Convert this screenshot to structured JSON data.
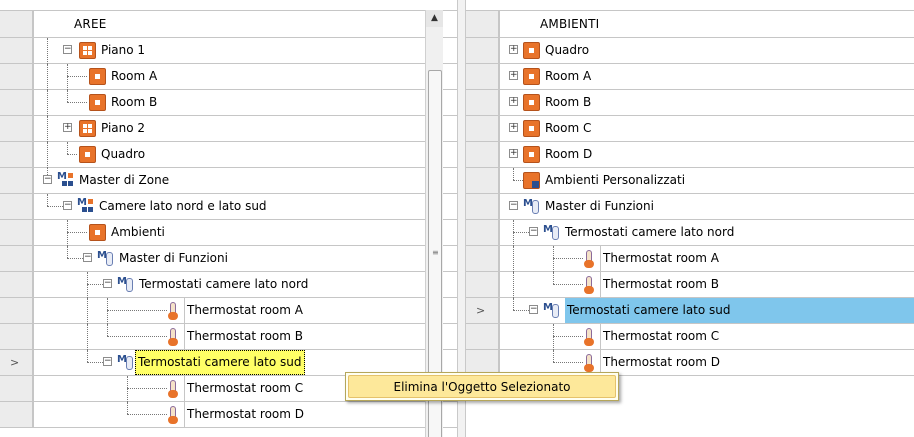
{
  "left": {
    "header": "AREE",
    "rows": [
      {
        "label": "Piano 1",
        "icon": "floor-icon",
        "expander": "minus"
      },
      {
        "label": "Room A",
        "icon": "room-icon"
      },
      {
        "label": "Room B",
        "icon": "room-icon"
      },
      {
        "label": "Piano 2",
        "icon": "floor-icon",
        "expander": "plus"
      },
      {
        "label": "Quadro",
        "icon": "room-icon"
      },
      {
        "label": "Master di Zone",
        "icon": "zone-master-icon",
        "expander": "minus"
      },
      {
        "label": "Camere lato nord e lato sud",
        "icon": "zone-master-icon",
        "expander": "minus"
      },
      {
        "label": "Ambienti",
        "icon": "room-icon"
      },
      {
        "label": "Master di Funzioni",
        "icon": "function-master-icon",
        "expander": "minus"
      },
      {
        "label": "Termostati camere lato nord",
        "icon": "function-master-icon",
        "expander": "minus"
      },
      {
        "label": "Thermostat room A",
        "icon": "thermostat-icon"
      },
      {
        "label": "Thermostat room B",
        "icon": "thermostat-icon"
      },
      {
        "label": "Termostati camere lato sud",
        "icon": "function-master-icon",
        "expander": "minus",
        "selected": true
      },
      {
        "label": "Thermostat room C",
        "icon": "thermostat-icon"
      },
      {
        "label": "Thermostat room D",
        "icon": "thermostat-icon"
      }
    ]
  },
  "right": {
    "header": "AMBIENTI",
    "rows": [
      {
        "label": "Quadro",
        "icon": "room-icon",
        "expander": "plus"
      },
      {
        "label": "Room A",
        "icon": "room-icon",
        "expander": "plus"
      },
      {
        "label": "Room B",
        "icon": "room-icon",
        "expander": "plus"
      },
      {
        "label": "Room C",
        "icon": "room-icon",
        "expander": "plus"
      },
      {
        "label": "Room D",
        "icon": "room-icon",
        "expander": "plus"
      },
      {
        "label": "Ambienti Personalizzati",
        "icon": "custom-room-icon"
      },
      {
        "label": "Master di Funzioni",
        "icon": "function-master-icon",
        "expander": "minus"
      },
      {
        "label": "Termostati camere lato nord",
        "icon": "function-master-icon",
        "expander": "minus"
      },
      {
        "label": "Thermostat room A",
        "icon": "thermostat-icon"
      },
      {
        "label": "Thermostat room B",
        "icon": "thermostat-icon"
      },
      {
        "label": "Termostati camere lato sud",
        "icon": "function-master-icon",
        "expander": "minus",
        "selected": true
      },
      {
        "label": "Thermostat room C",
        "icon": "thermostat-icon"
      },
      {
        "label": "Thermostat room D",
        "icon": "thermostat-icon"
      }
    ]
  },
  "context_menu": {
    "item": "Elimina l'Oggetto Selezionato"
  },
  "colors": {
    "accent_orange": "#e8732a",
    "selection_yellow": "#ffff66",
    "selection_blue": "#7fc6ec",
    "menu_highlight": "#fde89a"
  }
}
